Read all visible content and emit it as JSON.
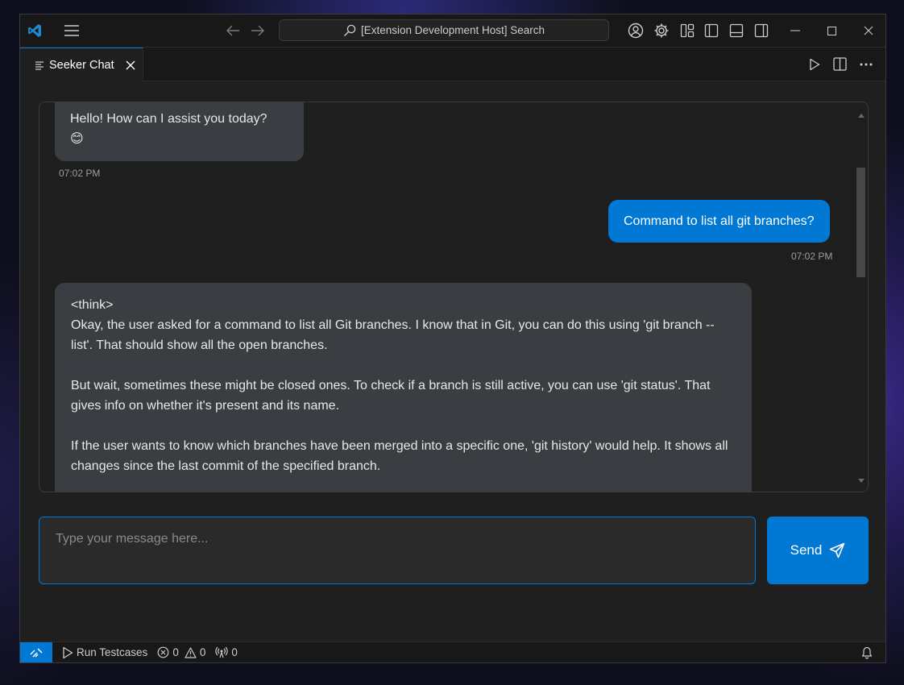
{
  "titlebar": {
    "search_placeholder": "[Extension Development Host] Search",
    "icons": [
      "vscode-logo-icon",
      "menu-icon",
      "back-arrow-icon",
      "forward-arrow-icon",
      "search-icon",
      "account-icon",
      "gear-icon",
      "customize-layout-icon",
      "toggle-primary-sidebar-icon",
      "toggle-panel-icon",
      "toggle-secondary-sidebar-icon",
      "minimize-icon",
      "maximize-icon",
      "close-icon"
    ]
  },
  "tab": {
    "label": "Seeker Chat",
    "icons": [
      "preview-icon",
      "close-icon"
    ]
  },
  "editor_actions": [
    "run-icon",
    "split-editor-icon",
    "more-actions-icon"
  ],
  "chat": {
    "messages": [
      {
        "role": "bot",
        "text": "Hello! How can I assist you today?",
        "emoji": "😊",
        "time": "07:02 PM"
      },
      {
        "role": "user",
        "text": "Command to list all git branches?",
        "time": "07:02 PM"
      },
      {
        "role": "bot",
        "paragraphs": [
          "<think>\nOkay, the user asked for a command to list all Git branches. I know that in Git, you can do this using 'git branch --list'. That should show all the open branches.",
          "But wait, sometimes these might be closed ones. To check if a branch is still active, you can use 'git status'. That gives info on whether it's present and its name.",
          "If the user wants to know which branches have been merged into a specific one, 'git history' would help. It shows all changes since the last commit of the specified branch."
        ]
      }
    ]
  },
  "input": {
    "placeholder": "Type your message here..."
  },
  "send": {
    "label": "Send",
    "icon": "send-icon"
  },
  "statusbar": {
    "run_testcases": "Run Testcases",
    "errors": "0",
    "warnings": "0",
    "ports": "0",
    "icons": [
      "remote-icon",
      "play-icon",
      "error-icon",
      "warning-icon",
      "broadcast-icon",
      "bell-icon"
    ]
  },
  "colors": {
    "accent": "#0078d4",
    "bot_bubble": "#3a3d41",
    "editor_bg": "#1f1f1f",
    "chrome_bg": "#181818"
  }
}
